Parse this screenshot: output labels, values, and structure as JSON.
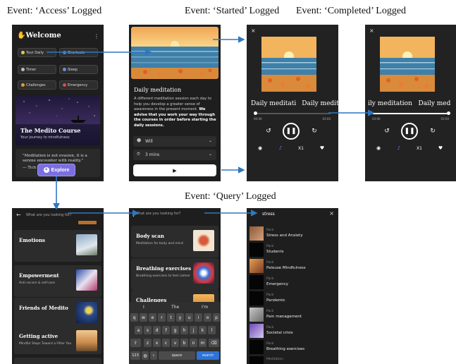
{
  "events": {
    "access": "Event: ‘Access’ Logged",
    "started": "Event: ‘Started’ Logged",
    "completed": "Event: ‘Completed’ Logged",
    "query": "Event: ‘Query’ Logged"
  },
  "home": {
    "title": "Welcome",
    "chips": [
      "Your Daily",
      "Shortcuts",
      "Timer",
      "Sleep",
      "Challenges",
      "Emergency"
    ],
    "course_title": "The Medito Course",
    "course_subtitle": "Your journey to mindfulness",
    "quote": "\"Meditation is not evasion, it is a serene encounter with reality.\"",
    "quote_author": "— Tich N... Laural",
    "explore_label": "Explore"
  },
  "daily": {
    "title": "Daily meditation",
    "desc_plain": "A different meditation session each day to help you develop a greater sense of awareness in the present moment. ",
    "desc_bold": "We advise that you work your way through the courses in order before starting the daily sessions.",
    "voice": "Will",
    "duration": "3 mins"
  },
  "player_started": {
    "title": "Daily meditati",
    "time_start": "00:00",
    "time_end": "03:00",
    "speed": "X1"
  },
  "player_completed": {
    "title": "ily meditation   Daily med",
    "time_start": "03:00",
    "time_end": "03:00",
    "speed": "X1"
  },
  "explore": {
    "placeholder": "What are you looking for?",
    "cards": [
      {
        "title": "Emotions",
        "sub": ""
      },
      {
        "title": "Empowerment",
        "sub": "Anti-racism & self-care"
      },
      {
        "title": "Friends of Medito",
        "sub": ""
      },
      {
        "title": "Getting active",
        "sub": "Mindful Steps Toward a Fitter You"
      }
    ]
  },
  "search_kb": {
    "placeholder": "What are you looking for?",
    "cards": [
      {
        "title": "Body scan",
        "sub": "Meditation for body and mind"
      },
      {
        "title": "Breathing exercises",
        "sub": "Breathing exercises to feel calmer"
      },
      {
        "title": "Challenges",
        "sub": "10 - day challenges to bring a"
      }
    ],
    "suggestions": [
      "I",
      "The",
      "I'm"
    ],
    "row1": [
      "q",
      "w",
      "e",
      "r",
      "t",
      "y",
      "u",
      "i",
      "o",
      "p"
    ],
    "row2": [
      "a",
      "s",
      "d",
      "f",
      "g",
      "h",
      "j",
      "k",
      "l"
    ],
    "row3": [
      "z",
      "x",
      "c",
      "v",
      "b",
      "n",
      "m"
    ],
    "num_key": "123",
    "space_key": "space",
    "search_key": "search"
  },
  "results": {
    "query": "stress",
    "pack_label": "Pack",
    "items": [
      "Stress and Anxiety",
      "Students",
      "Palouse Mindfulness",
      "Emergency",
      "Pandemic",
      "Pain management",
      "Societal crisis",
      "Breathing exercises",
      "Meditation"
    ]
  },
  "colors": {
    "accent": "#6b5fd6",
    "arrow": "#2f77c0",
    "dark_bg": "#1e1e1e"
  }
}
